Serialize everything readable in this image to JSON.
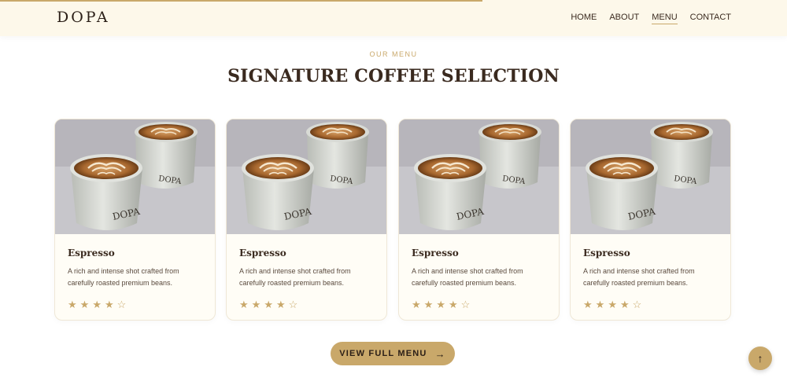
{
  "header": {
    "logo": "DOPA",
    "nav": [
      {
        "label": "HOME",
        "active": false
      },
      {
        "label": "ABOUT",
        "active": false
      },
      {
        "label": "MENU",
        "active": true
      },
      {
        "label": "CONTACT",
        "active": false
      }
    ],
    "scroll_progress": 0.613
  },
  "section": {
    "eyebrow": "OUR MENU",
    "title": "SIGNATURE COFFEE SELECTION"
  },
  "cards": [
    {
      "title": "Espresso",
      "description": "A rich and intense shot crafted from carefully roasted premium beans.",
      "rating": 4,
      "max_rating": 5,
      "cup_brand": "DOPA"
    },
    {
      "title": "Espresso",
      "description": "A rich and intense shot crafted from carefully roasted premium beans.",
      "rating": 4,
      "max_rating": 5,
      "cup_brand": "DOPA"
    },
    {
      "title": "Espresso",
      "description": "A rich and intense shot crafted from carefully roasted premium beans.",
      "rating": 4,
      "max_rating": 5,
      "cup_brand": "DOPA"
    },
    {
      "title": "Espresso",
      "description": "A rich and intense shot crafted from carefully roasted premium beans.",
      "rating": 4,
      "max_rating": 5,
      "cup_brand": "DOPA"
    }
  ],
  "cta": {
    "label": "VIEW FULL MENU",
    "icon": "arrow-right-icon"
  },
  "back_to_top": {
    "icon": "arrow-up-icon"
  },
  "colors": {
    "accent": "#c9a86a",
    "header_bg": "#fdf8ea",
    "text": "#3a2a1f"
  }
}
